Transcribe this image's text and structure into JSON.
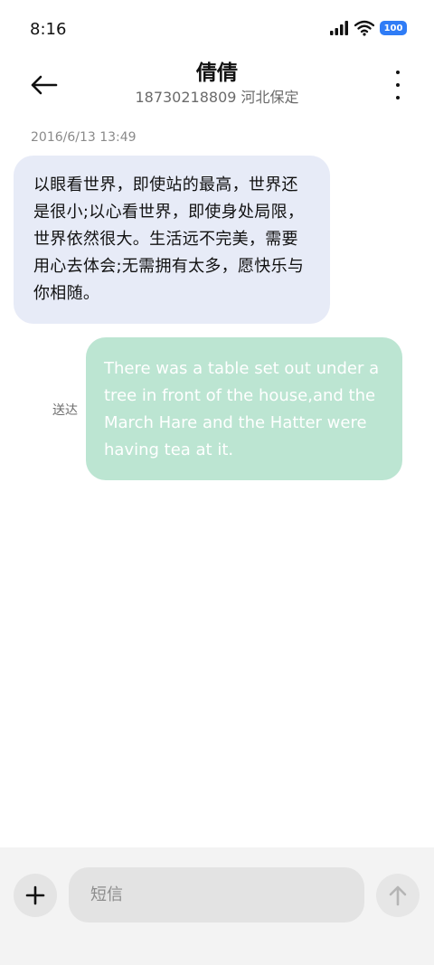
{
  "status_bar": {
    "time": "8:16",
    "battery": "100",
    "icons": [
      "signal-icon",
      "wifi-icon",
      "battery-icon"
    ]
  },
  "header": {
    "name": "倩倩",
    "subtitle": "18730218809 河北保定",
    "back_icon": "arrow-left-icon",
    "more_icon": "more-vertical-icon"
  },
  "messages": [
    {
      "direction": "incoming",
      "timestamp": "2016/6/13 13:49",
      "text": "以眼看世界，即使站的最高，世界还是很小;以心看世界，即使身处局限，世界依然很大。生活远不完美，需要用心去体会;无需拥有太多，愿快乐与你相随。"
    },
    {
      "direction": "outgoing",
      "status": "送达",
      "text": "There was a table set out under a tree in front of the house,and the March Hare and the Hatter were having tea at it."
    }
  ],
  "input_bar": {
    "placeholder": "短信",
    "value": "",
    "add_icon": "plus-icon",
    "send_icon": "arrow-up-icon"
  },
  "colors": {
    "incoming_bubble": "#e7ebf7",
    "outgoing_bubble": "#bce5d2",
    "battery": "#2f7cf6"
  }
}
